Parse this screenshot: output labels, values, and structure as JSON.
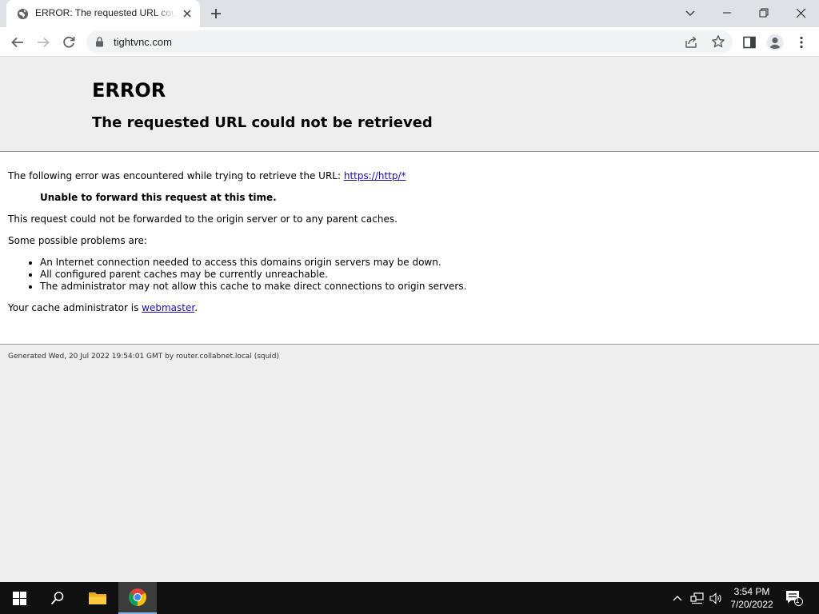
{
  "browser": {
    "tab_title": "ERROR: The requested URL could not be retrieved",
    "url": "tightvnc.com"
  },
  "page": {
    "heading": "ERROR",
    "subheading": "The requested URL could not be retrieved",
    "intro": "The following error was encountered while trying to retrieve the URL: ",
    "intro_link": "https://http/*",
    "reason": "Unable to forward this request at this time.",
    "detail": "This request could not be forwarded to the origin server or to any parent caches.",
    "problems_intro": "Some possible problems are:",
    "problems": [
      "An Internet connection needed to access this domains origin servers may be down.",
      "All configured parent caches may be currently unreachable.",
      "The administrator may not allow this cache to make direct connections to origin servers."
    ],
    "admin_prefix": "Your cache administrator is ",
    "admin_link": "webmaster",
    "admin_suffix": ".",
    "footer": "Generated Wed, 20 Jul 2022 19:54:01 GMT by router.collabnet.local (squid)"
  },
  "taskbar": {
    "time": "3:54 PM",
    "date": "7/20/2022",
    "notification_count": "1"
  },
  "icons": [
    "globe-icon",
    "close-icon",
    "plus-icon",
    "chevron-down-icon",
    "minimize-icon",
    "restore-icon",
    "close-window-icon",
    "back-arrow-icon",
    "forward-arrow-icon",
    "reload-icon",
    "lock-icon",
    "share-icon",
    "star-icon",
    "side-panel-icon",
    "profile-icon",
    "kebab-menu-icon",
    "windows-start-icon",
    "search-icon",
    "file-explorer-icon",
    "chrome-icon",
    "chevron-up-icon",
    "network-icon",
    "volume-icon",
    "notification-icon"
  ]
}
